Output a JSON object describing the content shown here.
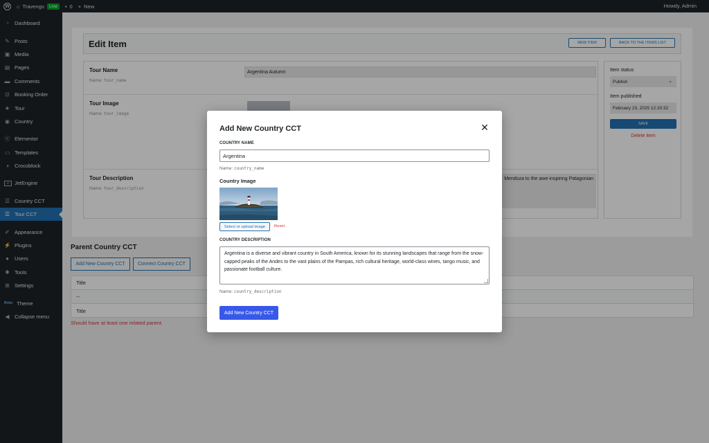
{
  "adminbar": {
    "site_name": "Travengo",
    "live_badge": "Live",
    "comments_count": "0",
    "new_label": "New",
    "howdy": "Howdy, Admin"
  },
  "sidebar": {
    "items": [
      {
        "label": "Dashboard",
        "icon": "dashboard-icon"
      },
      {
        "label": "Posts",
        "icon": "pin-icon"
      },
      {
        "label": "Media",
        "icon": "media-icon"
      },
      {
        "label": "Pages",
        "icon": "page-icon"
      },
      {
        "label": "Comments",
        "icon": "comment-icon"
      },
      {
        "label": "Booking Order",
        "icon": "cart-icon"
      },
      {
        "label": "Tour",
        "icon": "star-icon"
      },
      {
        "label": "Country",
        "icon": "globe-icon"
      },
      {
        "label": "Elementor",
        "icon": "elementor-icon"
      },
      {
        "label": "Templates",
        "icon": "folder-icon"
      },
      {
        "label": "Crocoblock",
        "icon": "crocoblock-icon"
      },
      {
        "label": "JetEngine",
        "icon": "jetengine-icon"
      },
      {
        "label": "Country CCT",
        "icon": "list-icon"
      },
      {
        "label": "Tour CCT",
        "icon": "list-icon"
      },
      {
        "label": "Appearance",
        "icon": "brush-icon"
      },
      {
        "label": "Plugins",
        "icon": "plugin-icon"
      },
      {
        "label": "Users",
        "icon": "user-icon"
      },
      {
        "label": "Tools",
        "icon": "wrench-icon"
      },
      {
        "label": "Settings",
        "icon": "settings-icon"
      },
      {
        "label": "Theme",
        "icon": "theme-icon",
        "icon_text": "Rvtu"
      },
      {
        "label": "Collapse menu",
        "icon": "collapse-icon"
      }
    ]
  },
  "edit": {
    "title": "Edit Item",
    "new_item_btn": "NEW ITEM",
    "back_btn": "BACK TO THE ITEMS LIST",
    "fields": [
      {
        "label": "Tour Name",
        "name_prefix": "Name:",
        "name": "tour_name",
        "value": "Argentina Autumn"
      },
      {
        "label": "Tour Image",
        "name_prefix": "Name:",
        "name": "tour_image"
      },
      {
        "label": "Tour Description",
        "name_prefix": "Name:",
        "name": "tour_description",
        "value": "Mendoza to the awe-inspiring Patagonian"
      }
    ],
    "item_status_label": "Item status",
    "item_status_value": "Publish",
    "item_published_label": "Item published",
    "item_published_value": "February 23, 2025 12:20:32",
    "save_btn": "SAVE",
    "delete_link": "Delete item"
  },
  "parent": {
    "title": "Parent Country CCT",
    "add_btn": "Add New Country CCT",
    "connect_btn": "Connect Country CCT",
    "table_header": "Title",
    "table_empty": "--",
    "table_footer": "Title",
    "error": "Should have at least one related parent."
  },
  "modal": {
    "title": "Add New Country CCT",
    "country_name_label": "COUNTRY NAME",
    "country_name_value": "Argentina",
    "country_name_hint_prefix": "Name:",
    "country_name_hint": "country_name",
    "country_image_label": "Country Image",
    "select_image_btn": "Select or upload image",
    "reset_link": "Reset",
    "country_desc_label": "COUNTRY DESCRIPTION",
    "country_desc_value": "Argentina is a diverse and vibrant country in South America, known for its stunning landscapes that range from the snow-capped peaks of the Andes to the vast plains of the Pampas, rich cultural heritage, world-class wines, tango music, and passionate football culture.",
    "country_desc_hint_prefix": "Name:",
    "country_desc_hint": "country_description",
    "submit_btn": "Add New Country CCT"
  },
  "colors": {
    "admin_dark": "#1d2327",
    "accent": "#2271b1",
    "submit": "#3858e9",
    "error": "#d63638"
  }
}
